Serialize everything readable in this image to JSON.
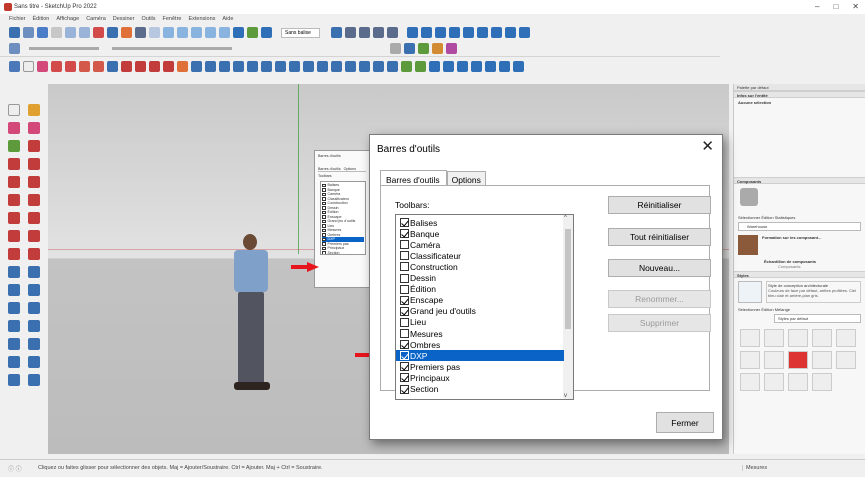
{
  "window": {
    "title": "Sans titre - SketchUp Pro 2022",
    "buttons": [
      "–",
      "□",
      "✕"
    ]
  },
  "menu": [
    "Fichier",
    "Édition",
    "Affichage",
    "Caméra",
    "Dessiner",
    "Outils",
    "Fenêtre",
    "Extensions",
    "Aide"
  ],
  "toolbar": {
    "tag_dropdown": "Sans balise"
  },
  "small_dialog": {
    "title": "Barres d'outils",
    "tabs": [
      "Barres d'outils",
      "Options"
    ],
    "label": "Toolbars",
    "items": [
      "Balises",
      "Banque",
      "Caméra",
      "Classificateur",
      "Construction",
      "Dessin",
      "Édition",
      "Enscape",
      "Grand jeu d'outils",
      "Lieu",
      "Mesures",
      "Ombres",
      "DXP",
      "Premiers pas",
      "Principaux",
      "Section"
    ]
  },
  "dialog": {
    "title": "Barres d'outils",
    "close": "✕",
    "tabs": [
      "Barres d'outils",
      "Options"
    ],
    "list_label": "Toolbars:",
    "items": [
      {
        "label": "Balises",
        "checked": true,
        "selected": false
      },
      {
        "label": "Banque",
        "checked": true,
        "selected": false
      },
      {
        "label": "Caméra",
        "checked": false,
        "selected": false
      },
      {
        "label": "Classificateur",
        "checked": false,
        "selected": false
      },
      {
        "label": "Construction",
        "checked": false,
        "selected": false
      },
      {
        "label": "Dessin",
        "checked": false,
        "selected": false
      },
      {
        "label": "Édition",
        "checked": false,
        "selected": false
      },
      {
        "label": "Enscape",
        "checked": true,
        "selected": false
      },
      {
        "label": "Grand jeu d'outils",
        "checked": true,
        "selected": false
      },
      {
        "label": "Lieu",
        "checked": false,
        "selected": false
      },
      {
        "label": "Mesures",
        "checked": false,
        "selected": false
      },
      {
        "label": "Ombres",
        "checked": true,
        "selected": false
      },
      {
        "label": "DXP",
        "checked": true,
        "selected": true
      },
      {
        "label": "Premiers pas",
        "checked": true,
        "selected": false
      },
      {
        "label": "Principaux",
        "checked": true,
        "selected": false
      },
      {
        "label": "Section",
        "checked": true,
        "selected": false
      }
    ],
    "buttons": {
      "reset": "Réinitialiser",
      "reset_all": "Tout réinitialiser",
      "new": "Nouveau...",
      "rename": "Renommer...",
      "delete": "Supprimer",
      "close": "Fermer"
    }
  },
  "right_panel": {
    "tray_title": "Palette par défaut",
    "entity_info": "Infos sur l'entité",
    "no_selection": "Aucune sélection",
    "components": "Composants",
    "components_tabs": "Sélectionner   Édition   Statistiques",
    "components_search": "Warehouse",
    "component_name": "Formation sur les composant...",
    "component_sample": "Échantillon de composants",
    "component_sub": "Composants",
    "styles": "Styles",
    "style_name": "Style de conception architecturale",
    "style_desc": "Couleurs de face par défaut, arêtes profilées. Ciel bleu clair et arrière-plan gris.",
    "styles_tabs": "Sélectionner   Édition   Mélange",
    "styles_dropdown": "Styles par défaut"
  },
  "status": {
    "text": "Cliquez ou faites glisser pour sélectionner des objets. Maj = Ajouter/Soustraire. Ctrl = Ajouter. Maj + Ctrl = Soustraire.",
    "measures": "Mesures"
  },
  "colors": {
    "selection": "#0a64c8",
    "arrow": "#e8141c"
  }
}
